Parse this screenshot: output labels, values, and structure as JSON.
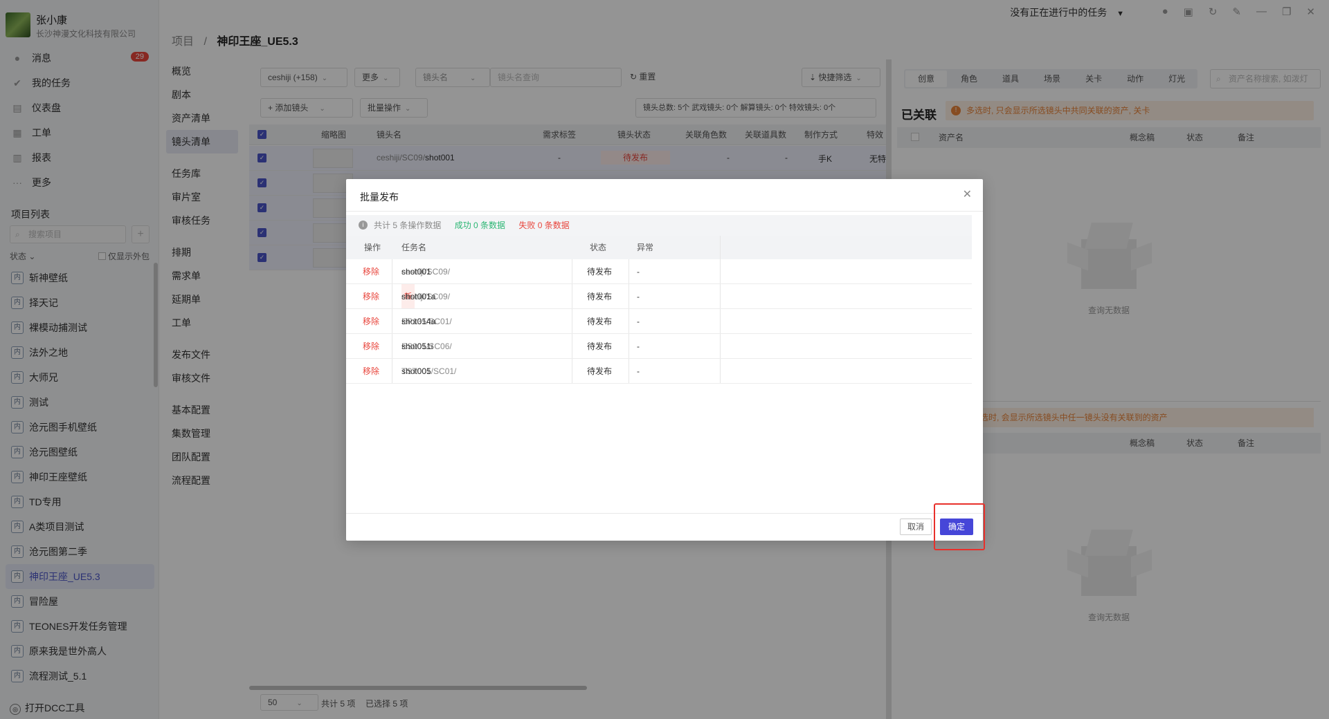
{
  "user": {
    "name": "张小康",
    "org": "长沙神漫文化科技有限公司"
  },
  "nav": [
    {
      "icon": "message-icon",
      "label": "消息",
      "badge": "29"
    },
    {
      "icon": "check-icon",
      "label": "我的任务"
    },
    {
      "icon": "dashboard-icon",
      "label": "仪表盘"
    },
    {
      "icon": "workorder-icon",
      "label": "工单"
    },
    {
      "icon": "report-icon",
      "label": "报表"
    },
    {
      "icon": "more-icon",
      "label": "更多"
    }
  ],
  "projects_title": "项目列表",
  "project_search_placeholder": "搜索项目",
  "project_filter": {
    "status": "状态",
    "outsource": "仅显示外包"
  },
  "project_tag": "内",
  "projects": [
    "斩神壁纸",
    "择天记",
    "裸模动捕测试",
    "法外之地",
    "大师兄",
    "测试",
    "沧元图手机壁纸",
    "沧元图壁纸",
    "神印王座壁纸",
    "TD专用",
    "A类项目测试",
    "沧元图第二季",
    "神印王座_UE5.3",
    "冒险屋",
    "TEONES开发任务管理",
    "原来我是世外高人",
    "流程测试_5.1"
  ],
  "active_project": "神印王座_UE5.3",
  "dcc_tool": "打开DCC工具",
  "titlebar": {
    "task_status": "没有正在进行中的任务"
  },
  "breadcrumb": {
    "root": "项目",
    "sep": "/",
    "current": "神印王座_UE5.3"
  },
  "subnav": [
    {
      "label": "概览"
    },
    {
      "label": "剧本"
    },
    {
      "label": "资产清单"
    },
    {
      "label": "镜头清单",
      "active": true
    },
    {
      "label": "任务库",
      "gap": true
    },
    {
      "label": "审片室"
    },
    {
      "label": "审核任务"
    },
    {
      "label": "排期",
      "gap": true
    },
    {
      "label": "需求单"
    },
    {
      "label": "延期单"
    },
    {
      "label": "工单"
    },
    {
      "label": "发布文件",
      "gap": true
    },
    {
      "label": "审核文件"
    },
    {
      "label": "基本配置",
      "gap": true
    },
    {
      "label": "集数管理"
    },
    {
      "label": "团队配置"
    },
    {
      "label": "流程配置"
    }
  ],
  "toolbar": {
    "episode": "ceshiji (+158)",
    "more": "更多",
    "shot_name": "镜头名",
    "shot_query": "镜头名查询",
    "reset": "重置",
    "quick_filter": "快捷筛选",
    "add_shot": "添加镜头",
    "batch_ops": "批量操作",
    "stats": "镜头总数: 5个   武戏镜头: 0个   解算镜头: 0个   特效镜头: 0个"
  },
  "grid_headers": [
    "缩略图",
    "镜头名",
    "需求标签",
    "镜头状态",
    "关联角色数",
    "关联道具数",
    "制作方式",
    "特效门"
  ],
  "grid_first_row": {
    "name_prefix": "ceshiji/SC09/",
    "name": "shot001",
    "tag": "-",
    "status": "待发布",
    "roles": "-",
    "props": "-",
    "method": "手K",
    "fx": "无特"
  },
  "grid_footer": {
    "page_size": "50",
    "total": "共计 5 项",
    "selected": "已选择 5 项"
  },
  "right_panel": {
    "tabs": [
      "创意",
      "角色",
      "道具",
      "场景",
      "关卡",
      "动作",
      "灯光"
    ],
    "search_placeholder": "资产名称搜索, 如泼灯",
    "title": "已关联",
    "warning": "多选时, 只会显示所选镜头中共同关联的资产, 关卡",
    "warning2": "选时, 会显示所选镜头中任一镜头没有关联到的资产",
    "headers": [
      "资产名",
      "概念稿",
      "状态",
      "备注"
    ],
    "empty": "查询无数据"
  },
  "modal": {
    "title": "批量发布",
    "summary_total": "共计 5 条操作数据",
    "summary_ok": "成功 0 条数据",
    "summary_fail": "失败 0 条数据",
    "headers": {
      "op": "操作",
      "task": "任务名",
      "status": "状态",
      "error": "异常"
    },
    "new_tag": "新",
    "rows": [
      {
        "op": "移除",
        "prefix": "ceshiji/SC09/",
        "name": "shot001",
        "is_new": false,
        "status": "待发布",
        "error": "-"
      },
      {
        "op": "移除",
        "prefix": "ceshiji/SC09/",
        "name": "shot001a",
        "is_new": true,
        "status": "待发布",
        "error": "-"
      },
      {
        "op": "移除",
        "prefix": "EP135/SC01/",
        "name": "shot014a",
        "is_new": false,
        "status": "待发布",
        "error": "-"
      },
      {
        "op": "移除",
        "prefix": "ES001/SC06/",
        "name": "shot051i",
        "is_new": false,
        "status": "待发布",
        "error": "-"
      },
      {
        "op": "移除",
        "prefix": "TST001/SC01/",
        "name": "shot005",
        "is_new": false,
        "status": "待发布",
        "error": "-"
      }
    ],
    "cancel": "取消",
    "confirm": "确定"
  },
  "colors": {
    "accent": "#4646d8",
    "danger": "#e8453c",
    "success": "#2bb673",
    "warning": "#e8843a",
    "highlight": "#e8302b"
  }
}
